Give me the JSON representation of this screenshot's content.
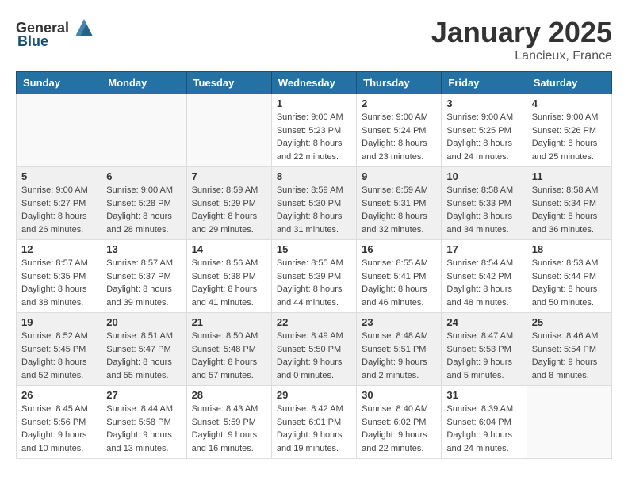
{
  "header": {
    "logo_general": "General",
    "logo_blue": "Blue",
    "month_title": "January 2025",
    "location": "Lancieux, France"
  },
  "weekdays": [
    "Sunday",
    "Monday",
    "Tuesday",
    "Wednesday",
    "Thursday",
    "Friday",
    "Saturday"
  ],
  "weeks": [
    [
      {
        "day": "",
        "info": ""
      },
      {
        "day": "",
        "info": ""
      },
      {
        "day": "",
        "info": ""
      },
      {
        "day": "1",
        "info": "Sunrise: 9:00 AM\nSunset: 5:23 PM\nDaylight: 8 hours\nand 22 minutes."
      },
      {
        "day": "2",
        "info": "Sunrise: 9:00 AM\nSunset: 5:24 PM\nDaylight: 8 hours\nand 23 minutes."
      },
      {
        "day": "3",
        "info": "Sunrise: 9:00 AM\nSunset: 5:25 PM\nDaylight: 8 hours\nand 24 minutes."
      },
      {
        "day": "4",
        "info": "Sunrise: 9:00 AM\nSunset: 5:26 PM\nDaylight: 8 hours\nand 25 minutes."
      }
    ],
    [
      {
        "day": "5",
        "info": "Sunrise: 9:00 AM\nSunset: 5:27 PM\nDaylight: 8 hours\nand 26 minutes."
      },
      {
        "day": "6",
        "info": "Sunrise: 9:00 AM\nSunset: 5:28 PM\nDaylight: 8 hours\nand 28 minutes."
      },
      {
        "day": "7",
        "info": "Sunrise: 8:59 AM\nSunset: 5:29 PM\nDaylight: 8 hours\nand 29 minutes."
      },
      {
        "day": "8",
        "info": "Sunrise: 8:59 AM\nSunset: 5:30 PM\nDaylight: 8 hours\nand 31 minutes."
      },
      {
        "day": "9",
        "info": "Sunrise: 8:59 AM\nSunset: 5:31 PM\nDaylight: 8 hours\nand 32 minutes."
      },
      {
        "day": "10",
        "info": "Sunrise: 8:58 AM\nSunset: 5:33 PM\nDaylight: 8 hours\nand 34 minutes."
      },
      {
        "day": "11",
        "info": "Sunrise: 8:58 AM\nSunset: 5:34 PM\nDaylight: 8 hours\nand 36 minutes."
      }
    ],
    [
      {
        "day": "12",
        "info": "Sunrise: 8:57 AM\nSunset: 5:35 PM\nDaylight: 8 hours\nand 38 minutes."
      },
      {
        "day": "13",
        "info": "Sunrise: 8:57 AM\nSunset: 5:37 PM\nDaylight: 8 hours\nand 39 minutes."
      },
      {
        "day": "14",
        "info": "Sunrise: 8:56 AM\nSunset: 5:38 PM\nDaylight: 8 hours\nand 41 minutes."
      },
      {
        "day": "15",
        "info": "Sunrise: 8:55 AM\nSunset: 5:39 PM\nDaylight: 8 hours\nand 44 minutes."
      },
      {
        "day": "16",
        "info": "Sunrise: 8:55 AM\nSunset: 5:41 PM\nDaylight: 8 hours\nand 46 minutes."
      },
      {
        "day": "17",
        "info": "Sunrise: 8:54 AM\nSunset: 5:42 PM\nDaylight: 8 hours\nand 48 minutes."
      },
      {
        "day": "18",
        "info": "Sunrise: 8:53 AM\nSunset: 5:44 PM\nDaylight: 8 hours\nand 50 minutes."
      }
    ],
    [
      {
        "day": "19",
        "info": "Sunrise: 8:52 AM\nSunset: 5:45 PM\nDaylight: 8 hours\nand 52 minutes."
      },
      {
        "day": "20",
        "info": "Sunrise: 8:51 AM\nSunset: 5:47 PM\nDaylight: 8 hours\nand 55 minutes."
      },
      {
        "day": "21",
        "info": "Sunrise: 8:50 AM\nSunset: 5:48 PM\nDaylight: 8 hours\nand 57 minutes."
      },
      {
        "day": "22",
        "info": "Sunrise: 8:49 AM\nSunset: 5:50 PM\nDaylight: 9 hours\nand 0 minutes."
      },
      {
        "day": "23",
        "info": "Sunrise: 8:48 AM\nSunset: 5:51 PM\nDaylight: 9 hours\nand 2 minutes."
      },
      {
        "day": "24",
        "info": "Sunrise: 8:47 AM\nSunset: 5:53 PM\nDaylight: 9 hours\nand 5 minutes."
      },
      {
        "day": "25",
        "info": "Sunrise: 8:46 AM\nSunset: 5:54 PM\nDaylight: 9 hours\nand 8 minutes."
      }
    ],
    [
      {
        "day": "26",
        "info": "Sunrise: 8:45 AM\nSunset: 5:56 PM\nDaylight: 9 hours\nand 10 minutes."
      },
      {
        "day": "27",
        "info": "Sunrise: 8:44 AM\nSunset: 5:58 PM\nDaylight: 9 hours\nand 13 minutes."
      },
      {
        "day": "28",
        "info": "Sunrise: 8:43 AM\nSunset: 5:59 PM\nDaylight: 9 hours\nand 16 minutes."
      },
      {
        "day": "29",
        "info": "Sunrise: 8:42 AM\nSunset: 6:01 PM\nDaylight: 9 hours\nand 19 minutes."
      },
      {
        "day": "30",
        "info": "Sunrise: 8:40 AM\nSunset: 6:02 PM\nDaylight: 9 hours\nand 22 minutes."
      },
      {
        "day": "31",
        "info": "Sunrise: 8:39 AM\nSunset: 6:04 PM\nDaylight: 9 hours\nand 24 minutes."
      },
      {
        "day": "",
        "info": ""
      }
    ]
  ]
}
